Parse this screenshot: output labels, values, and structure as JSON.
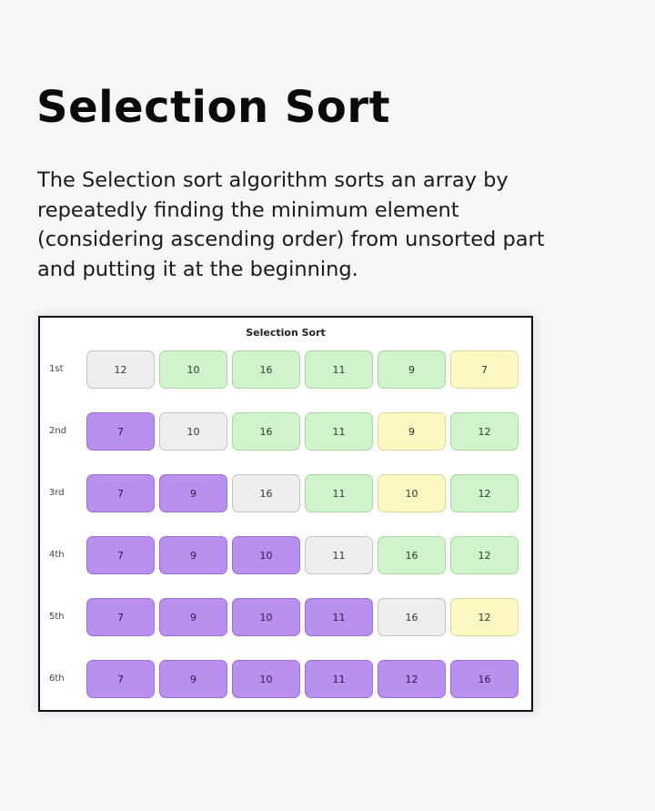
{
  "header": {
    "title": "Selection Sort",
    "description": "The Selection sort algorithm sorts an array by repeatedly finding the minimum element (considering ascending order) from unsorted part and putting it at the beginning."
  },
  "figure": {
    "title": "Selection Sort",
    "legend_colors": {
      "current": "#eeeeef",
      "unsorted": "#cff3ca",
      "minimum": "#fbf8c2",
      "sorted": "#b98ff0"
    },
    "passes": [
      {
        "label": "1st",
        "cells": [
          {
            "value": "12",
            "state": "current"
          },
          {
            "value": "10",
            "state": "unsorted"
          },
          {
            "value": "16",
            "state": "unsorted"
          },
          {
            "value": "11",
            "state": "unsorted"
          },
          {
            "value": "9",
            "state": "unsorted"
          },
          {
            "value": "7",
            "state": "minimum"
          }
        ]
      },
      {
        "label": "2nd",
        "cells": [
          {
            "value": "7",
            "state": "sorted"
          },
          {
            "value": "10",
            "state": "current"
          },
          {
            "value": "16",
            "state": "unsorted"
          },
          {
            "value": "11",
            "state": "unsorted"
          },
          {
            "value": "9",
            "state": "minimum"
          },
          {
            "value": "12",
            "state": "unsorted"
          }
        ]
      },
      {
        "label": "3rd",
        "cells": [
          {
            "value": "7",
            "state": "sorted"
          },
          {
            "value": "9",
            "state": "sorted"
          },
          {
            "value": "16",
            "state": "current"
          },
          {
            "value": "11",
            "state": "unsorted"
          },
          {
            "value": "10",
            "state": "minimum"
          },
          {
            "value": "12",
            "state": "unsorted"
          }
        ]
      },
      {
        "label": "4th",
        "cells": [
          {
            "value": "7",
            "state": "sorted"
          },
          {
            "value": "9",
            "state": "sorted"
          },
          {
            "value": "10",
            "state": "sorted"
          },
          {
            "value": "11",
            "state": "current"
          },
          {
            "value": "16",
            "state": "unsorted"
          },
          {
            "value": "12",
            "state": "unsorted"
          }
        ]
      },
      {
        "label": "5th",
        "cells": [
          {
            "value": "7",
            "state": "sorted"
          },
          {
            "value": "9",
            "state": "sorted"
          },
          {
            "value": "10",
            "state": "sorted"
          },
          {
            "value": "11",
            "state": "sorted"
          },
          {
            "value": "16",
            "state": "current"
          },
          {
            "value": "12",
            "state": "minimum"
          }
        ]
      },
      {
        "label": "6th",
        "cells": [
          {
            "value": "7",
            "state": "sorted"
          },
          {
            "value": "9",
            "state": "sorted"
          },
          {
            "value": "10",
            "state": "sorted"
          },
          {
            "value": "11",
            "state": "sorted"
          },
          {
            "value": "12",
            "state": "sorted"
          },
          {
            "value": "16",
            "state": "sorted"
          }
        ]
      }
    ]
  }
}
